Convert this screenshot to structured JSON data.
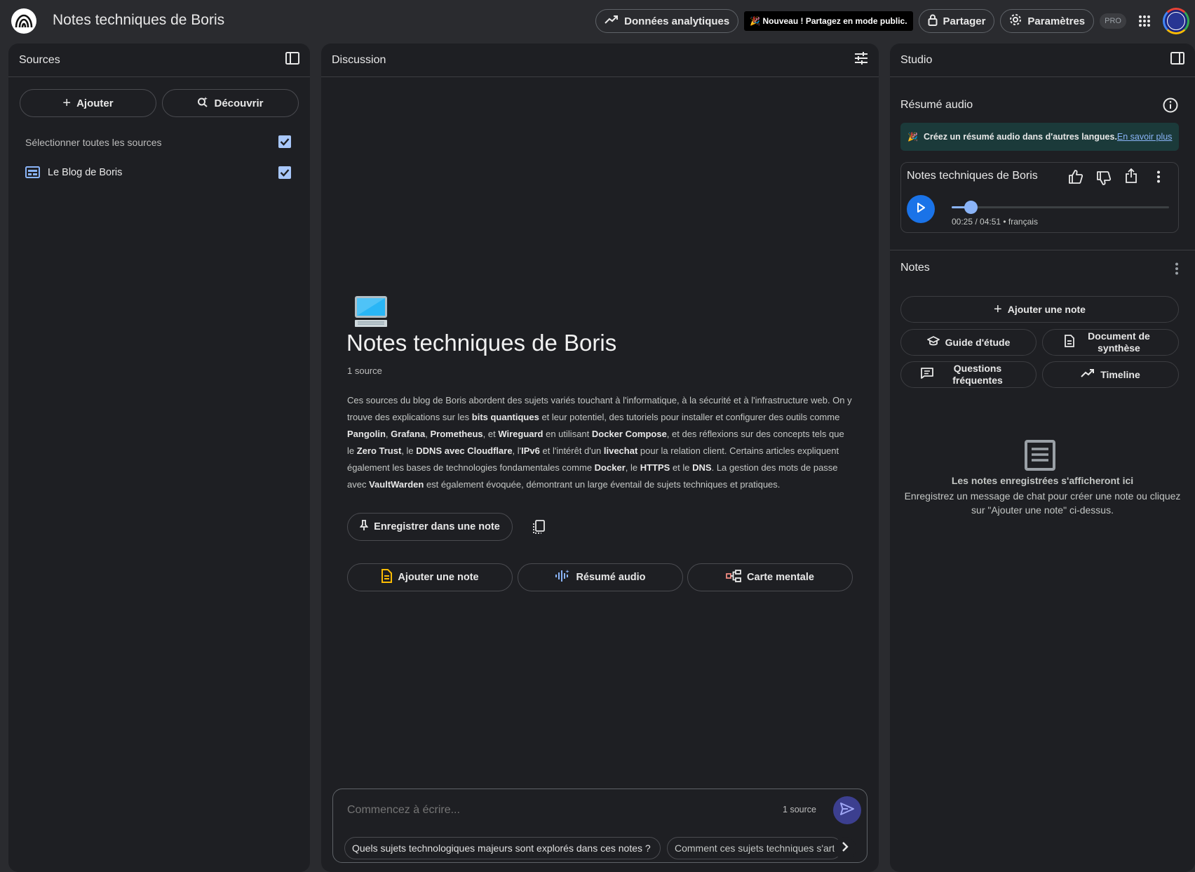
{
  "header": {
    "title": "Notes techniques de Boris",
    "analytics_label": "Données analytiques",
    "promo_text": "🎉 Nouveau ! Partagez en mode public.",
    "share_label": "Partager",
    "settings_label": "Paramètres",
    "pro_badge": "PRO"
  },
  "sources": {
    "title": "Sources",
    "add_label": "Ajouter",
    "discover_label": "Découvrir",
    "select_all_label": "Sélectionner toutes les sources",
    "items": [
      {
        "label": "Le Blog de Boris",
        "checked": true
      }
    ]
  },
  "chat": {
    "title": "Discussion",
    "notebook_title": "Notes techniques de Boris",
    "source_count": "1 source",
    "summary_parts": [
      [
        "Ces sources du blog de Boris abordent des sujets variés touchant à l'informatique, à la sécurité et à l'infrastructure web. On y trouve des explications sur les ",
        false
      ],
      [
        "bits quantiques",
        true
      ],
      [
        " et leur potentiel, des tutoriels pour installer et configurer des outils comme ",
        false
      ],
      [
        "Pangolin",
        true
      ],
      [
        ", ",
        false
      ],
      [
        "Grafana",
        true
      ],
      [
        ", ",
        false
      ],
      [
        "Prometheus",
        true
      ],
      [
        ", et ",
        false
      ],
      [
        "Wireguard",
        true
      ],
      [
        " en utilisant ",
        false
      ],
      [
        "Docker Compose",
        true
      ],
      [
        ", et des réflexions sur des concepts tels que le ",
        false
      ],
      [
        "Zero Trust",
        true
      ],
      [
        ", le ",
        false
      ],
      [
        "DDNS avec Cloudflare",
        true
      ],
      [
        ", l'",
        false
      ],
      [
        "IPv6",
        true
      ],
      [
        " et l'intérêt d'un ",
        false
      ],
      [
        "livechat",
        true
      ],
      [
        " pour la relation client. Certains articles expliquent également les bases de technologies fondamentales comme ",
        false
      ],
      [
        "Docker",
        true
      ],
      [
        ", le ",
        false
      ],
      [
        "HTTPS",
        true
      ],
      [
        " et le ",
        false
      ],
      [
        "DNS",
        true
      ],
      [
        ". La gestion des mots de passe avec ",
        false
      ],
      [
        "VaultWarden",
        true
      ],
      [
        " est également évoquée, démontrant un large éventail de sujets techniques et pratiques.",
        false
      ]
    ],
    "save_note_label": "Enregistrer dans une note",
    "action_add_note": "Ajouter une note",
    "action_audio": "Résumé audio",
    "action_mindmap": "Carte mentale",
    "input_placeholder": "Commencez à écrire...",
    "input_source_count": "1 source",
    "suggestions": [
      "Quels sujets technologiques majeurs sont explorés dans ces notes ?",
      "Comment ces sujets techniques s'articulent-ils ?"
    ]
  },
  "studio": {
    "title": "Studio",
    "audio_section_title": "Résumé audio",
    "banner_text": "Créez un résumé audio dans d'autres langues.",
    "banner_link": "En savoir plus",
    "audio_title": "Notes techniques de Boris",
    "audio_time": "00:25 / 04:51 • français",
    "audio_progress": 0.086,
    "notes_title": "Notes",
    "add_note_label": "Ajouter une note",
    "tiles": [
      "Guide d'étude",
      "Document de synthèse",
      "Questions fréquentes",
      "Timeline"
    ],
    "empty_title": "Les notes enregistrées s'afficheront ici",
    "empty_desc": "Enregistrez un message de chat pour créer une note ou cliquez sur \"Ajouter une note\" ci-dessus."
  },
  "colors": {
    "background": "#2a2b2f",
    "panel": "#1e1f23",
    "accent_blue": "#1a73e8",
    "check_blue": "#a8c7fa",
    "banner_teal": "#1b3a3a"
  }
}
